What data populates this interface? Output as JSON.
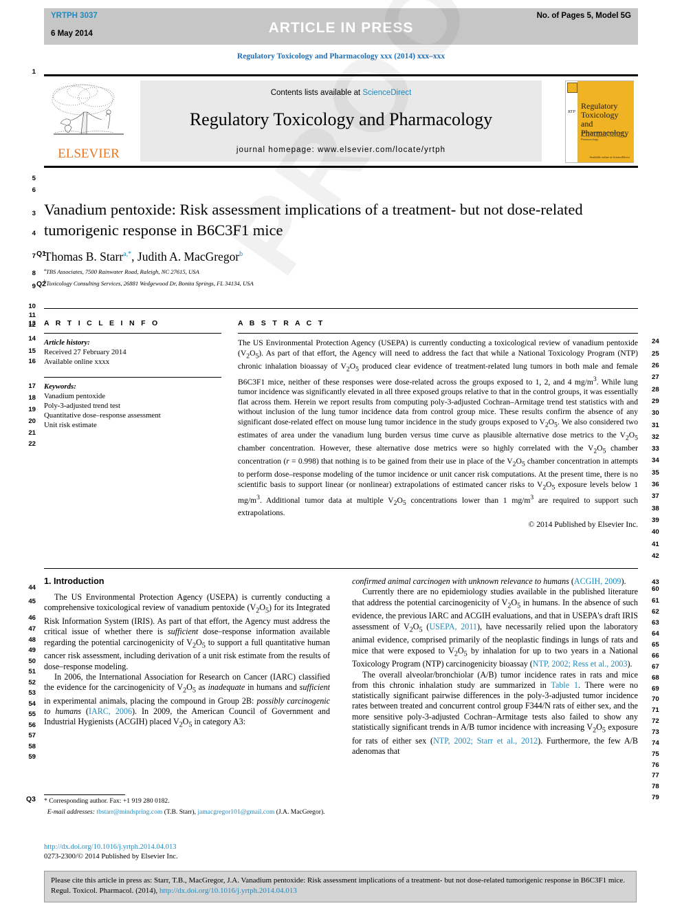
{
  "press_banner": {
    "reference": "YRTPH 3037",
    "date": "6 May 2014",
    "article_in_press": "ARTICLE  IN  PRESS",
    "pages_model": "No. of Pages 5, Model 5G"
  },
  "running_head": "Regulatory Toxicology and Pharmacology xxx (2014) xxx–xxx",
  "masthead": {
    "elsevier_wordmark": "ELSEVIER",
    "contents_prefix": "Contents lists available at ",
    "sciencedirect": "ScienceDirect",
    "journal_title": "Regulatory Toxicology and Pharmacology",
    "homepage": "journal homepage: www.elsevier.com/locate/yrtph",
    "cover": {
      "spine_label": "RTP",
      "title": "Regulatory Toxicology and Pharmacology",
      "subtitle": "official journal of the International Society of Regulatory Toxicology and Pharmacology",
      "footer": "Available online at\nScienceDirect"
    }
  },
  "article": {
    "title": "Vanadium pentoxide: Risk assessment implications of a treatment- but not dose-related tumorigenic response in B6C3F1 mice",
    "authors": "Thomas B. Starr a,*, Judith A. MacGregor b",
    "author_1": "Thomas B. Starr",
    "author_1_sup": "a,*",
    "author_2": "Judith A. MacGregor",
    "author_2_sup": "b",
    "affiliation_a_sup": "a",
    "affiliation_a": "TBS Associates, 7500 Rainwater Road, Raleigh, NC 27615, USA",
    "affiliation_b_sup": "b",
    "affiliation_b": "Toxicology Consulting Services, 26881 Wedgewood Dr, Bonita Springs, FL 34134, USA"
  },
  "article_info": {
    "heading": "A R T I C L E   I N F O",
    "history_label": "Article history:",
    "history_lines": "Received 27 February 2014\nAvailable online xxxx",
    "keywords_label": "Keywords:",
    "keywords": [
      "Vanadium pentoxide",
      "Poly-3-adjusted trend test",
      "Quantitative dose–response assessment",
      "Unit risk estimate"
    ]
  },
  "abstract": {
    "heading": "A B S T R A C T",
    "text": "The US Environmental Protection Agency (USEPA) is currently conducting a toxicological review of vanadium pentoxide (V2O5). As part of that effort, the Agency will need to address the fact that while a National Toxicology Program (NTP) chronic inhalation bioassay of V2O5 produced clear evidence of treatment-related lung tumors in both male and female B6C3F1 mice, neither of these responses were dose-related across the groups exposed to 1, 2, and 4 mg/m3. While lung tumor incidence was significantly elevated in all three exposed groups relative to that in the control groups, it was essentially flat across them. Herein we report results from computing poly-3-adjusted Cochran–Armitage trend test statistics with and without inclusion of the lung tumor incidence data from control group mice. These results confirm the absence of any significant dose-related effect on mouse lung tumor incidence in the study groups exposed to V2O5. We also considered two estimates of area under the vanadium lung burden versus time curve as plausible alternative dose metrics to the V2O5 chamber concentration. However, these alternative dose metrics were so highly correlated with the V2O5 chamber concentration (r = 0.998) that nothing is to be gained from their use in place of the V2O5 chamber concentration in attempts to perform dose–response modeling of the tumor incidence or unit cancer risk computations. At the present time, there is no scientific basis to support linear (or nonlinear) extrapolations of estimated cancer risks to V2O5 exposure levels below 1 mg/m3. Additional tumor data at multiple V2O5 concentrations lower than 1 mg/m3 are required to support such extrapolations.",
    "copyright": "© 2014 Published by Elsevier Inc."
  },
  "introduction": {
    "heading": "1. Introduction",
    "left_paragraphs": [
      "The US Environmental Protection Agency (USEPA) is currently conducting a comprehensive toxicological review of vanadium pentoxide (V2O5) for its Integrated Risk Information System (IRIS). As part of that effort, the Agency must address the critical issue of whether there is sufficient dose–response information available regarding the potential carcinogenicity of V2O5 to support a full quantitative human cancer risk assessment, including derivation of a unit risk estimate from the results of dose–response modeling.",
      "In 2006, the International Association for Research on Cancer (IARC) classified the evidence for the carcinogenicity of V2O5 as inadequate in humans and sufficient in experimental animals, placing the compound in Group 2B: possibly carcinogenic to humans (IARC, 2006). In 2009, the American Council of Government and Industrial Hygienists (ACGIH) placed V2O5 in category A3:"
    ],
    "right_paragraphs": [
      "confirmed animal carcinogen with unknown relevance to humans (ACGIH, 2009).",
      "Currently there are no epidemiology studies available in the published literature that address the potential carcinogenicity of V2O5 in humans. In the absence of such evidence, the previous IARC and ACGIH evaluations, and that in USEPA's draft IRIS assessment of V2O5 (USEPA, 2011), have necessarily relied upon the laboratory animal evidence, comprised primarily of the neoplastic findings in lungs of rats and mice that were exposed to V2O5 by inhalation for up to two years in a National Toxicology Program (NTP) carcinogenicity bioassay (NTP, 2002; Ress et al., 2003).",
      "The overall alveolar/bronchiolar (A/B) tumor incidence rates in rats and mice from this chronic inhalation study are summarized in Table 1. There were no statistically significant pairwise differences in the poly-3-adjusted tumor incidence rates between treated and concurrent control group F344/N rats of either sex, and the more sensitive poly-3-adjusted Cochran–Armitage tests also failed to show any statistically significant trends in A/B tumor incidence with increasing V2O5 exposure for rats of either sex (NTP, 2002; Starr et al., 2012). Furthermore, the few A/B adenomas that"
    ]
  },
  "footnote": {
    "corresponding": "* Corresponding author. Fax: +1 919 280 0182.",
    "email_label": "E-mail addresses:",
    "email_1": "tbstarr@mindspring.com",
    "email_1_owner": " (T.B. Starr), ",
    "email_2": "jamacgregor101@gmail.com",
    "email_2_owner": " (J.A. MacGregor)."
  },
  "doi_block": {
    "doi_url": "http://dx.doi.org/10.1016/j.yrtph.2014.04.013",
    "issn_line": "0273-2300/© 2014 Published by Elsevier Inc."
  },
  "citation_box": {
    "text_before": "Please cite this article in press as: Starr, T.B., MacGregor, J.A. Vanadium pentoxide: Risk assessment implications of a treatment- but not dose-related tumorigenic response in B6C3F1 mice. Regul. Toxicol. Pharmacol. (2014), ",
    "link": "http://dx.doi.org/10.1016/j.yrtph.2014.04.013"
  },
  "watermark": "PROOF",
  "query_tags": [
    "Q1",
    "Q2",
    "Q3"
  ],
  "line_numbers": {
    "left": [
      "1",
      "5",
      "6",
      "3",
      "4",
      "7",
      "8",
      "9",
      "10",
      "11",
      "12",
      "13",
      "14",
      "15",
      "16",
      "17",
      "18",
      "19",
      "20",
      "21",
      "22",
      "44",
      "45",
      "46",
      "47",
      "48",
      "49",
      "50",
      "51",
      "52",
      "53",
      "54",
      "55",
      "56",
      "57",
      "58",
      "59"
    ],
    "right": [
      "24",
      "25",
      "26",
      "27",
      "28",
      "29",
      "30",
      "31",
      "32",
      "33",
      "34",
      "35",
      "36",
      "37",
      "38",
      "39",
      "40",
      "41",
      "42",
      "43",
      "60",
      "61",
      "62",
      "63",
      "64",
      "65",
      "66",
      "67",
      "68",
      "69",
      "70",
      "71",
      "72",
      "73",
      "74",
      "75",
      "76",
      "77",
      "78",
      "79"
    ]
  },
  "colors": {
    "link": "#1f8ac0",
    "banner": "#c6c6c6",
    "elsevier_orange": "#e87722",
    "cover_yellow": "#f0b323",
    "cite_box": "#d4d4d4"
  }
}
